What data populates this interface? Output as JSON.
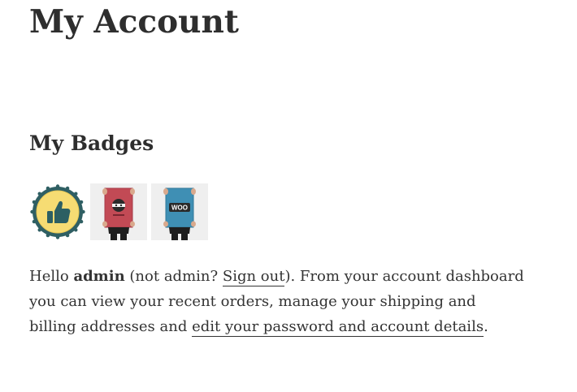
{
  "page": {
    "title": "My Account"
  },
  "badges": {
    "heading": "My Badges",
    "items": [
      {
        "icon": "thumbs-up-seal-icon",
        "colors": {
          "ring": "#2f5f63",
          "fill": "#f6dc73",
          "thumb": "#2c5f63"
        }
      },
      {
        "icon": "red-poster-badge-icon",
        "colors": {
          "bg": "#efefef",
          "poster": "#c24a55"
        }
      },
      {
        "icon": "woo-poster-badge-icon",
        "label": "WOO",
        "colors": {
          "bg": "#efefef",
          "poster": "#3f8fb4"
        }
      }
    ]
  },
  "intro": {
    "hello": "Hello",
    "username": "admin",
    "not_user_prefix": "(not admin?",
    "sign_out": "Sign out",
    "after_sign_out": "). From your account dashboard you can view your recent orders, manage your shipping and billing addresses and",
    "edit_link": "edit your password and account details",
    "end": "."
  }
}
